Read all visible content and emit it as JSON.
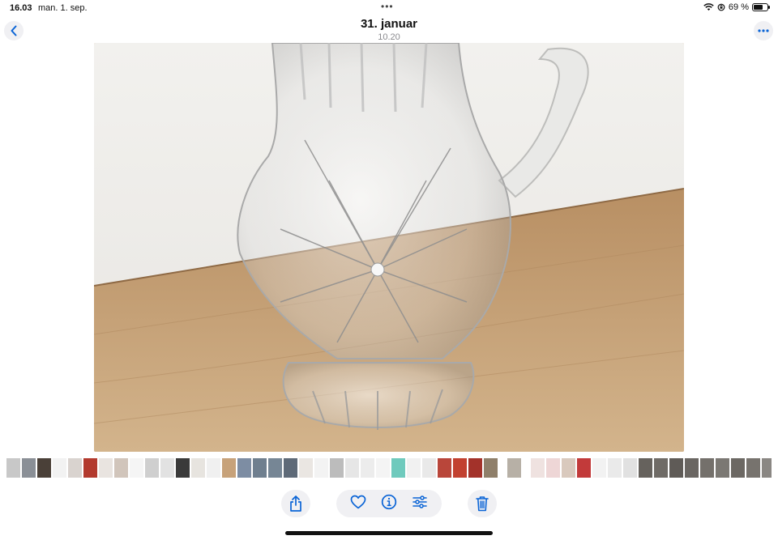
{
  "status_bar": {
    "time": "16.03",
    "date": "man. 1. sep.",
    "battery_text": "69 %",
    "battery_level": 0.69,
    "icons": [
      "wifi-icon",
      "orientation-lock-icon",
      "battery-icon"
    ]
  },
  "header": {
    "title": "31. januar",
    "subtitle": "10.20",
    "back_icon": "chevron-left-icon",
    "more_icon": "ellipsis-icon"
  },
  "toolbar": {
    "share_icon": "share-icon",
    "favorite_icon": "heart-icon",
    "info_icon": "info-icon",
    "edit_icon": "sliders-icon",
    "delete_icon": "trash-icon"
  },
  "colors": {
    "accent": "#0a64d6",
    "toolbar_bg": "#f0f0f3",
    "wall": "#eeece8",
    "table": "#c9a57a"
  },
  "thumbnails": [
    "#c8c8c8",
    "#8a8f96",
    "#4a4038",
    "#f2f2f2",
    "#d9d3cf",
    "#b33a2e",
    "#e9e4e0",
    "#d1c5bb",
    "#f5f5f5",
    "#cfcfcf",
    "#e2e2e2",
    "#3a3a3a",
    "#e7e4df",
    "#f0f0f0",
    "#c7a27a",
    "#7d8da3",
    "#6f7f8f",
    "#768695",
    "#5e6a78",
    "#eae6e2",
    "#f3f3f3",
    "#bcbcbc",
    "#e6e6e6",
    "#ececec",
    "#f4f4f4",
    "#6fcabd",
    "#f1f1f1",
    "#e9e9e9",
    "#b9463a",
    "#c2402f",
    "#a3322a",
    "#8f7f6a",
    "gap",
    "#b7b0a6",
    "gap",
    "#efe2e0",
    "#eed6d6",
    "#d9c9bd",
    "#c23a3a",
    "#f2f2f2",
    "#eaeaea",
    "#e1e1e1",
    "#66625d",
    "#6f6b66",
    "#5f5b57",
    "#6a6662",
    "#74706b",
    "#7b7873",
    "#6c6863",
    "#77736e",
    "#8a8783",
    "#918d88",
    "#87837e",
    "#837f7a",
    "#f2f2f2",
    "#e8e8e8",
    "#e4b27a",
    "#c98b3e",
    "#b77a35",
    "#d59a4c",
    "#c68d43",
    "#f3f3f3",
    "#eeeeee",
    "#ededed",
    "#2f3b2a",
    "#c8a0a4",
    "#d9b0b5",
    "#e2c7c9"
  ]
}
